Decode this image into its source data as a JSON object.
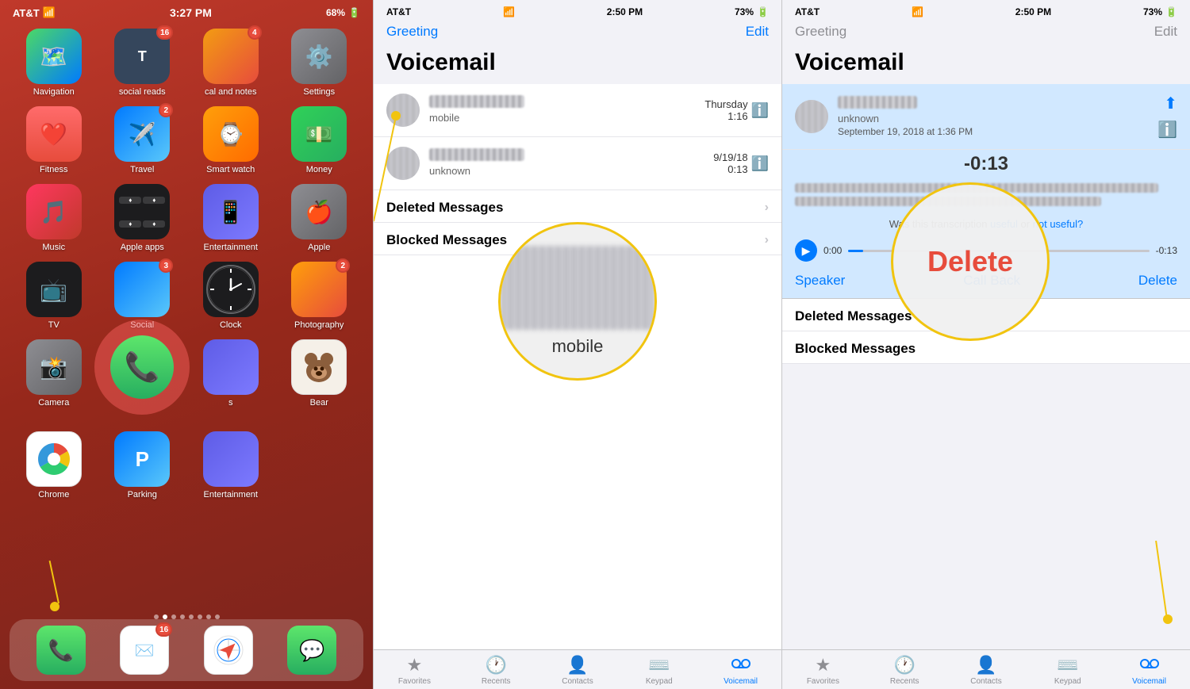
{
  "panel1": {
    "status": {
      "carrier": "AT&T",
      "time": "3:27 PM",
      "battery": "68%"
    },
    "apps": [
      {
        "id": "navigation",
        "label": "Navigation",
        "icon": "🗺️",
        "color": "icon-maps",
        "badge": null
      },
      {
        "id": "social-reads",
        "label": "social reads",
        "icon": "📱",
        "color": "icon-tumblr",
        "badge": "16"
      },
      {
        "id": "cal-notes",
        "label": "cal and notes",
        "icon": "📅",
        "color": "icon-folder1",
        "badge": "4"
      },
      {
        "id": "settings",
        "label": "Settings",
        "icon": "⚙️",
        "color": "icon-settings",
        "badge": null
      },
      {
        "id": "fitness",
        "label": "Fitness",
        "icon": "❤️",
        "color": "icon-fitness",
        "badge": null
      },
      {
        "id": "travel",
        "label": "Travel",
        "icon": "✈️",
        "color": "icon-travel",
        "badge": "2"
      },
      {
        "id": "smart-watch",
        "label": "Smart watch",
        "icon": "⌚",
        "color": "icon-swatch",
        "badge": null
      },
      {
        "id": "money",
        "label": "Money",
        "icon": "💰",
        "color": "icon-money",
        "badge": null
      },
      {
        "id": "music",
        "label": "Music",
        "icon": "🎵",
        "color": "icon-music",
        "badge": null
      },
      {
        "id": "apple-apps",
        "label": "Apple apps",
        "icon": "📱",
        "color": "icon-apple",
        "badge": null
      },
      {
        "id": "entertainment",
        "label": "Entertainment",
        "icon": "📺",
        "color": "icon-entertainment",
        "badge": null
      },
      {
        "id": "apple",
        "label": "Apple",
        "icon": "🍎",
        "color": "icon-apple2",
        "badge": null
      },
      {
        "id": "tv",
        "label": "TV",
        "icon": "📺",
        "color": "icon-tv",
        "badge": null
      },
      {
        "id": "social",
        "label": "Social",
        "icon": "👥",
        "color": "icon-social",
        "badge": "3"
      },
      {
        "id": "clock",
        "label": "Clock",
        "icon": "🕐",
        "color": "icon-clock",
        "badge": null
      },
      {
        "id": "photography",
        "label": "Photography",
        "icon": "📷",
        "color": "icon-photography",
        "badge": "2"
      },
      {
        "id": "camera",
        "label": "Camera",
        "icon": "📸",
        "color": "icon-camera",
        "badge": null
      },
      {
        "id": "phone-main",
        "label": "",
        "icon": "📞",
        "color": "icon-phone-small",
        "badge": null
      },
      {
        "id": "apps-extra",
        "label": "s",
        "icon": "📱",
        "color": "icon-social",
        "badge": null
      },
      {
        "id": "bear",
        "label": "Bear",
        "icon": "🐻",
        "color": "icon-bear",
        "badge": null
      },
      {
        "id": "chrome",
        "label": "Chrome",
        "icon": "🌐",
        "color": "icon-chrome",
        "badge": null
      },
      {
        "id": "parking",
        "label": "Parking",
        "icon": "🅿️",
        "color": "icon-parking",
        "badge": null
      },
      {
        "id": "entertainment2",
        "label": "Entertainment",
        "icon": "📺",
        "color": "icon-ent2",
        "badge": null
      }
    ],
    "dock": [
      {
        "id": "phone-dock",
        "icon": "📞",
        "color": "icon-phone-dock",
        "badge": null
      },
      {
        "id": "gmail-dock",
        "icon": "✉️",
        "color": "icon-gmail",
        "badge": "16"
      },
      {
        "id": "safari-dock",
        "icon": "🧭",
        "color": "icon-safari",
        "badge": null
      },
      {
        "id": "messages-dock",
        "icon": "💬",
        "color": "icon-messages",
        "badge": null
      }
    ],
    "annotation": {
      "dot_label": "annotation-dot"
    }
  },
  "panel2": {
    "status": {
      "carrier": "AT&T",
      "time": "2:50 PM",
      "battery": "73%"
    },
    "nav": {
      "greeting": "Greeting",
      "edit": "Edit"
    },
    "title": "Voicemail",
    "items": [
      {
        "type": "contact",
        "name_blurred": true,
        "caller_type": "mobile",
        "date": "Thursday",
        "duration": "1:16"
      },
      {
        "type": "contact",
        "name_blurred": true,
        "caller_type": "unknown",
        "date": "9/19/18",
        "duration": "0:13"
      }
    ],
    "sections": [
      {
        "label": "Deleted Messages"
      },
      {
        "label": "Blocked Messages"
      }
    ],
    "magnify": {
      "label": "mobile"
    },
    "tabs": [
      {
        "id": "favorites",
        "label": "Favorites",
        "icon": "★",
        "active": false
      },
      {
        "id": "recents",
        "label": "Recents",
        "icon": "🕐",
        "active": false
      },
      {
        "id": "contacts",
        "label": "Contacts",
        "icon": "👤",
        "active": false
      },
      {
        "id": "keypad",
        "label": "Keypad",
        "icon": "⌨️",
        "active": false
      },
      {
        "id": "voicemail",
        "label": "Voicemail",
        "icon": "📧",
        "active": true
      }
    ]
  },
  "panel3": {
    "status": {
      "carrier": "AT&T",
      "time": "2:50 PM",
      "battery": "73%"
    },
    "nav": {
      "greeting": "Greeting",
      "edit": "Edit"
    },
    "title": "Voicemail",
    "detail": {
      "caller_type": "unknown",
      "date": "September 19, 2018 at 1:36 PM",
      "counter": "-0:13",
      "transcription_hint": "Was this transcription",
      "useful": "useful",
      "or": "or",
      "not_useful": "not useful?",
      "time_start": "0:00",
      "time_end": "-0:13"
    },
    "bottom_actions": [
      {
        "id": "speaker",
        "label": "Speaker"
      },
      {
        "id": "callback",
        "label": "Call Back"
      },
      {
        "id": "delete",
        "label": "Delete"
      }
    ],
    "sections": [
      {
        "label": "Deleted Messages"
      },
      {
        "label": "Blocked Messages"
      }
    ],
    "delete_circle": {
      "label": "Delete"
    },
    "tabs": [
      {
        "id": "favorites",
        "label": "Favorites",
        "icon": "★",
        "active": false
      },
      {
        "id": "recents",
        "label": "Recents",
        "icon": "🕐",
        "active": false
      },
      {
        "id": "contacts",
        "label": "Contacts",
        "icon": "👤",
        "active": false
      },
      {
        "id": "keypad",
        "label": "Keypad",
        "icon": "⌨️",
        "active": false
      },
      {
        "id": "voicemail",
        "label": "Voicemail",
        "icon": "📧",
        "active": true
      }
    ]
  }
}
